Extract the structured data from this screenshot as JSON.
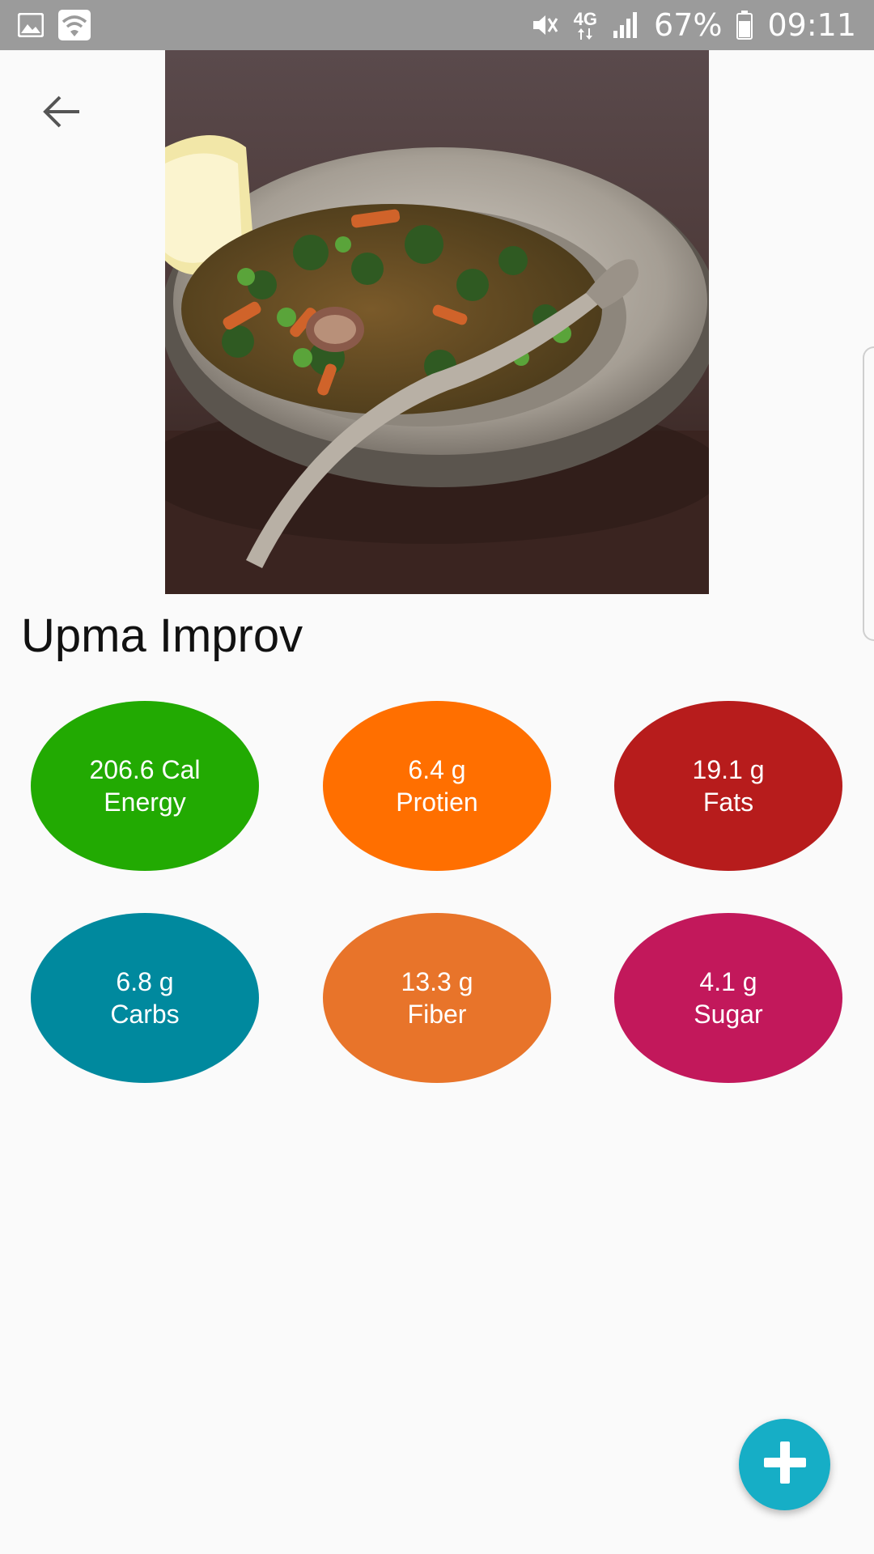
{
  "status_bar": {
    "battery_percent": "67%",
    "time": "09:11",
    "network_label": "4G",
    "icons": [
      "gallery-icon",
      "wifi-icon",
      "mute-icon",
      "network-4g-icon",
      "signal-icon",
      "battery-icon"
    ]
  },
  "header": {
    "back_icon": "arrow-back-icon"
  },
  "recipe": {
    "title": "Upma Improv",
    "image": "food-photo"
  },
  "nutrients": [
    {
      "value": "206.6 Cal",
      "label": "Energy",
      "color": "#22aa02"
    },
    {
      "value": "6.4 g",
      "label": "Protien",
      "color": "#ff6f00"
    },
    {
      "value": "19.1 g",
      "label": "Fats",
      "color": "#b71c1c"
    },
    {
      "value": "6.8 g",
      "label": "Carbs",
      "color": "#00899e"
    },
    {
      "value": "13.3 g",
      "label": "Fiber",
      "color": "#e8742a"
    },
    {
      "value": "4.1 g",
      "label": "Sugar",
      "color": "#c2185b"
    }
  ],
  "fab": {
    "icon": "plus-icon",
    "color": "#16aec6"
  }
}
